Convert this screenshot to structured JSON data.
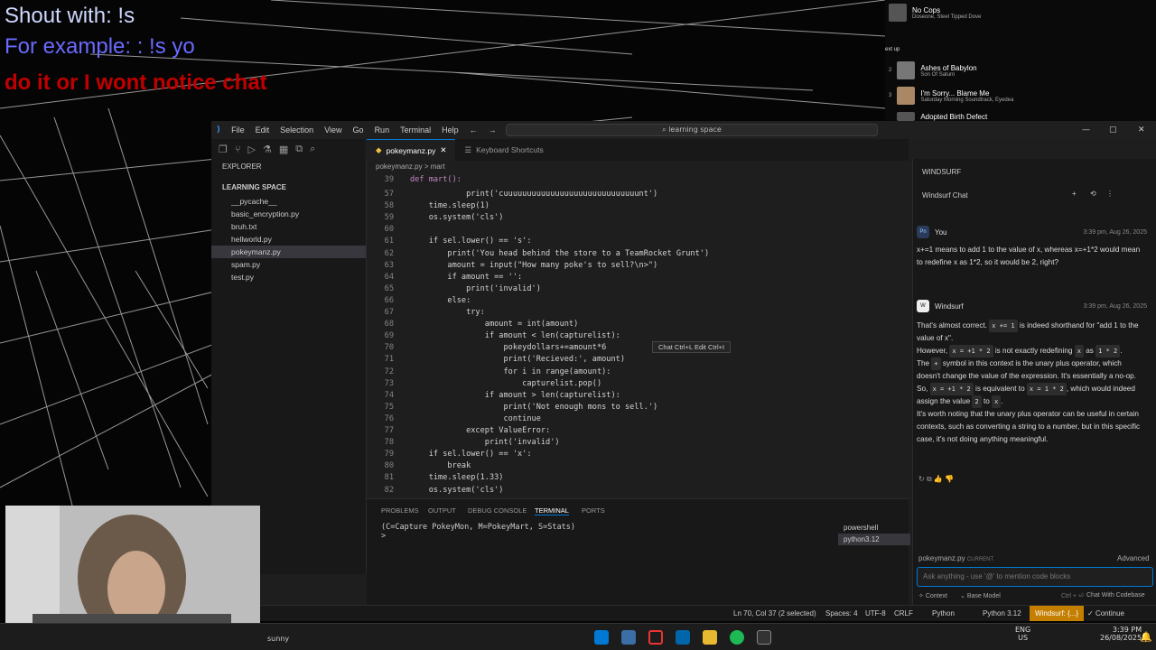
{
  "overlay": {
    "line1": "Shout with: !s",
    "line2": "For example: : !s yo",
    "line3": "do it or I wont notice chat"
  },
  "spotify": {
    "current_title": "No Cops",
    "current_artist": "Doseone, Steel Tipped Dove",
    "next_up": "ext up",
    "q2_num": "2",
    "q2_title": "Ashes of Babylon",
    "q2_artist": "Son Of Saturn",
    "q3_num": "3",
    "q3_title": "I'm Sorry... Blame Me",
    "q3_artist": "Saturday Morning Soundtrack, Eyedea",
    "q4_title": "Adopted Birth Defect"
  },
  "titlebar": {
    "menu": [
      "File",
      "Edit",
      "Selection",
      "View",
      "Go",
      "Run",
      "Terminal",
      "Help"
    ],
    "search": "learning space"
  },
  "explorer": {
    "header": "EXPLORER",
    "folder": "LEARNING SPACE",
    "files": [
      "__pycache__",
      "basic_encryption.py",
      "bruh.txt",
      "hellworld.py",
      "pokeymanz.py",
      "spam.py",
      "test.py"
    ]
  },
  "tabs": {
    "active": "pokeymanz.py",
    "other": "Keyboard Shortcuts"
  },
  "breadcrumb": {
    "file": "pokeymanz.py",
    "sep": ">",
    "symbol": "mart"
  },
  "code": [
    {
      "n": "39",
      "t": "def mart():"
    },
    {
      "n": "57",
      "t": "            print('cuuuuuuuuuuuuuuuuuuuuuuuuuuuuunt')"
    },
    {
      "n": "58",
      "t": "    time.sleep(1)"
    },
    {
      "n": "59",
      "t": "    os.system('cls')"
    },
    {
      "n": "60",
      "t": ""
    },
    {
      "n": "61",
      "t": "    if sel.lower() == 's':"
    },
    {
      "n": "62",
      "t": "        print('You head behind the store to a TeamRocket Grunt')"
    },
    {
      "n": "63",
      "t": "        amount = input(\"How many poke's to sell?\\n>\")"
    },
    {
      "n": "64",
      "t": "        if amount == '':"
    },
    {
      "n": "65",
      "t": "            print('invalid')"
    },
    {
      "n": "66",
      "t": "        else:"
    },
    {
      "n": "67",
      "t": "            try:"
    },
    {
      "n": "68",
      "t": "                amount = int(amount)"
    },
    {
      "n": "69",
      "t": "                if amount < len(capturelist):"
    },
    {
      "n": "70",
      "t": "                    pokeydollars+=amount*6"
    },
    {
      "n": "71",
      "t": "                    print('Recieved:', amount)"
    },
    {
      "n": "72",
      "t": "                    for i in range(amount):"
    },
    {
      "n": "73",
      "t": "                        capturelist.pop()"
    },
    {
      "n": "74",
      "t": "                if amount > len(capturelist):"
    },
    {
      "n": "75",
      "t": "                    print('Not enough mons to sell.')"
    },
    {
      "n": "76",
      "t": "                    continue"
    },
    {
      "n": "77",
      "t": "            except ValueError:"
    },
    {
      "n": "78",
      "t": "                print('invalid')"
    },
    {
      "n": "79",
      "t": "    if sel.lower() == 'x':"
    },
    {
      "n": "80",
      "t": "        break"
    },
    {
      "n": "81",
      "t": "    time.sleep(1.33)"
    },
    {
      "n": "82",
      "t": "    os.system('cls')"
    }
  ],
  "hint": "Chat  Ctrl+L   Edit  Ctrl+I",
  "panel": {
    "tabs": [
      "PROBLEMS",
      "OUTPUT",
      "DEBUG CONSOLE",
      "TERMINAL",
      "PORTS"
    ],
    "terminal_line": "(C=Capture PokeyMon, M=PokeyMart, S=Stats)",
    "terminal_prompt": ">",
    "terminals": [
      "powershell",
      "python3.12"
    ]
  },
  "windsurf": {
    "header": "WINDSURF",
    "subheader": "Windsurf Chat",
    "user_initials": "Pn",
    "user_name": "You",
    "user_ts": "3:39 pm, Aug 26, 2025",
    "user_msg": "x+=1 means to add 1 to the value of x, whereas x=+1*2 would mean to redefine x as 1*2, so it would be 2, right?",
    "bot_name": "Windsurf",
    "bot_ts": "3:39 pm, Aug 26, 2025",
    "r1a": "That's almost correct.",
    "r1code": "x += 1",
    "r1b": "is indeed shorthand for \"add 1 to the value of x\".",
    "r2a": "However,",
    "r2code": "x = +1 * 2",
    "r2b": "is not exactly redefining",
    "r2code2": "x",
    "r2c": "as",
    "r2code3": "1 * 2",
    "r3a": "The",
    "r3code": "+",
    "r3b": "symbol in this context is the unary plus operator, which doesn't change the value of the expression. It's essentially a no-op.",
    "r4a": "So,",
    "r4code": "x = +1 * 2",
    "r4b": "is equivalent to",
    "r4code2": "x = 1 * 2",
    "r4c": ", which would indeed assign the value",
    "r4code3": "2",
    "r4d": "to",
    "r4code4": "x",
    "r5": "It's worth noting that the unary plus operator can be useful in certain contexts, such as converting a string to a number, but in this specific case, it's not doing anything meaningful.",
    "context_file": "pokeymanz.py",
    "context_tag": "CURRENT",
    "advanced": "Advanced",
    "ask_placeholder": "Ask anything - use '@' to mention code blocks",
    "context_btn": "Context",
    "model_btn": "Base Model",
    "shortcut": "Ctrl + ⏎",
    "codebase": "Chat With Codebase"
  },
  "status": {
    "pos": "Ln 70, Col 37 (2 selected)",
    "spaces": "Spaces: 4",
    "enc": "UTF-8",
    "eol": "CRLF",
    "lang": "Python",
    "interp": "Python 3.12",
    "windsurf": "Windsurf: {...}",
    "continue": "Continue"
  },
  "taskbar": {
    "lang": "ENG",
    "region": "US",
    "time": "3:39 PM",
    "date": "26/08/2025",
    "weather": "sunny"
  }
}
